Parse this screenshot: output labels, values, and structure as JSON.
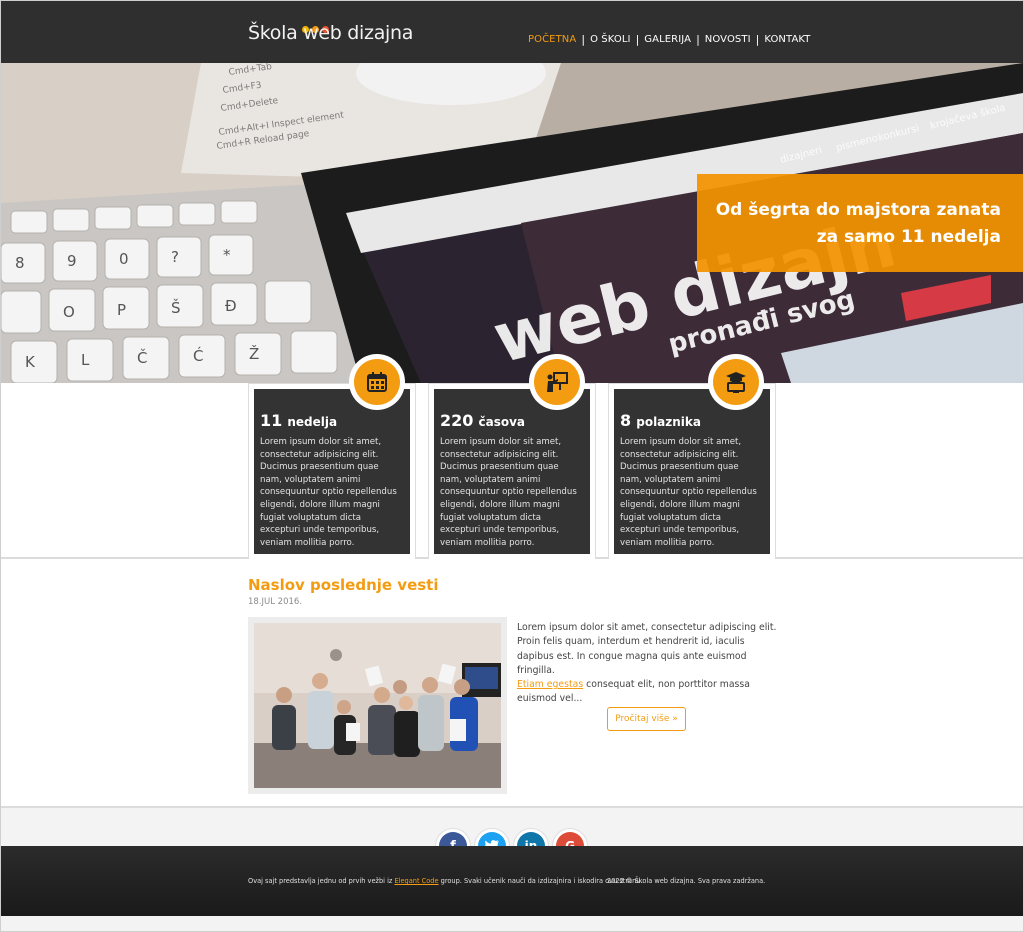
{
  "brand": {
    "logo_text": "Škola web dizajna",
    "dot_colors": [
      "#f6b400",
      "#f39c12",
      "#e6542d"
    ],
    "accent": "#f39c12"
  },
  "nav": {
    "items": [
      "POČETNA",
      "O ŠKOLI",
      "GALERIJA",
      "NOVOSTI",
      "KONTAKT"
    ],
    "active_index": 0
  },
  "hero": {
    "line1": "Od šegrta do majstora zanata",
    "line2": "za samo 11 nedelja"
  },
  "features": [
    {
      "number": "11",
      "unit": "nedelja",
      "icon": "calendar-icon",
      "text": "Lorem ipsum dolor sit amet, consectetur adipisicing elit. Ducimus praesentium quae nam, voluptatem animi consequuntur optio repellendus eligendi, dolore illum magni fugiat voluptatum dicta excepturi unde temporibus, veniam mollitia porro."
    },
    {
      "number": "220",
      "unit": "časova",
      "icon": "teacher-board-icon",
      "text": "Lorem ipsum dolor sit amet, consectetur adipisicing elit. Ducimus praesentium quae nam, voluptatem animi consequuntur optio repellendus eligendi, dolore illum magni fugiat voluptatum dicta excepturi unde temporibus, veniam mollitia porro."
    },
    {
      "number": "8",
      "unit": "polaznika",
      "icon": "graduate-computer-icon",
      "text": "Lorem ipsum dolor sit amet, consectetur adipisicing elit. Ducimus praesentium quae nam, voluptatem animi consequuntur optio repellendus eligendi, dolore illum magni fugiat voluptatum dicta excepturi unde temporibus, veniam mollitia porro."
    }
  ],
  "news": {
    "title": "Naslov poslednje vesti",
    "date": "18.JUL 2016.",
    "body_start": "Lorem ipsum dolor sit amet, consectetur adipiscing elit. Proin felis quam, interdum et hendrerit id, iaculis dapibus est. In congue magna quis ante euismod fringilla.",
    "link_text": "Etiam egestas",
    "body_end": "consequat elit, non porttitor massa euismod vel...",
    "read_more": "Pročitaj više »"
  },
  "social": [
    {
      "name": "facebook",
      "glyph": "f",
      "color": "#3b5998"
    },
    {
      "name": "twitter",
      "glyph": "t",
      "color": "#1da1f2"
    },
    {
      "name": "linkedin",
      "glyph": "in",
      "color": "#0e76a8"
    },
    {
      "name": "google-plus",
      "glyph": "G",
      "color": "#dd4b39"
    }
  ],
  "footer": {
    "left_before": "Ovaj sajt predstavlja jednu od prvih vežbi iz",
    "left_link": "Elegant Code",
    "left_after": "group. Svaki učenik nauči da izdizajnira i iskodira ovu stranu.",
    "right": "2022 © Škola web dizajna. Sva prava zadržana."
  }
}
